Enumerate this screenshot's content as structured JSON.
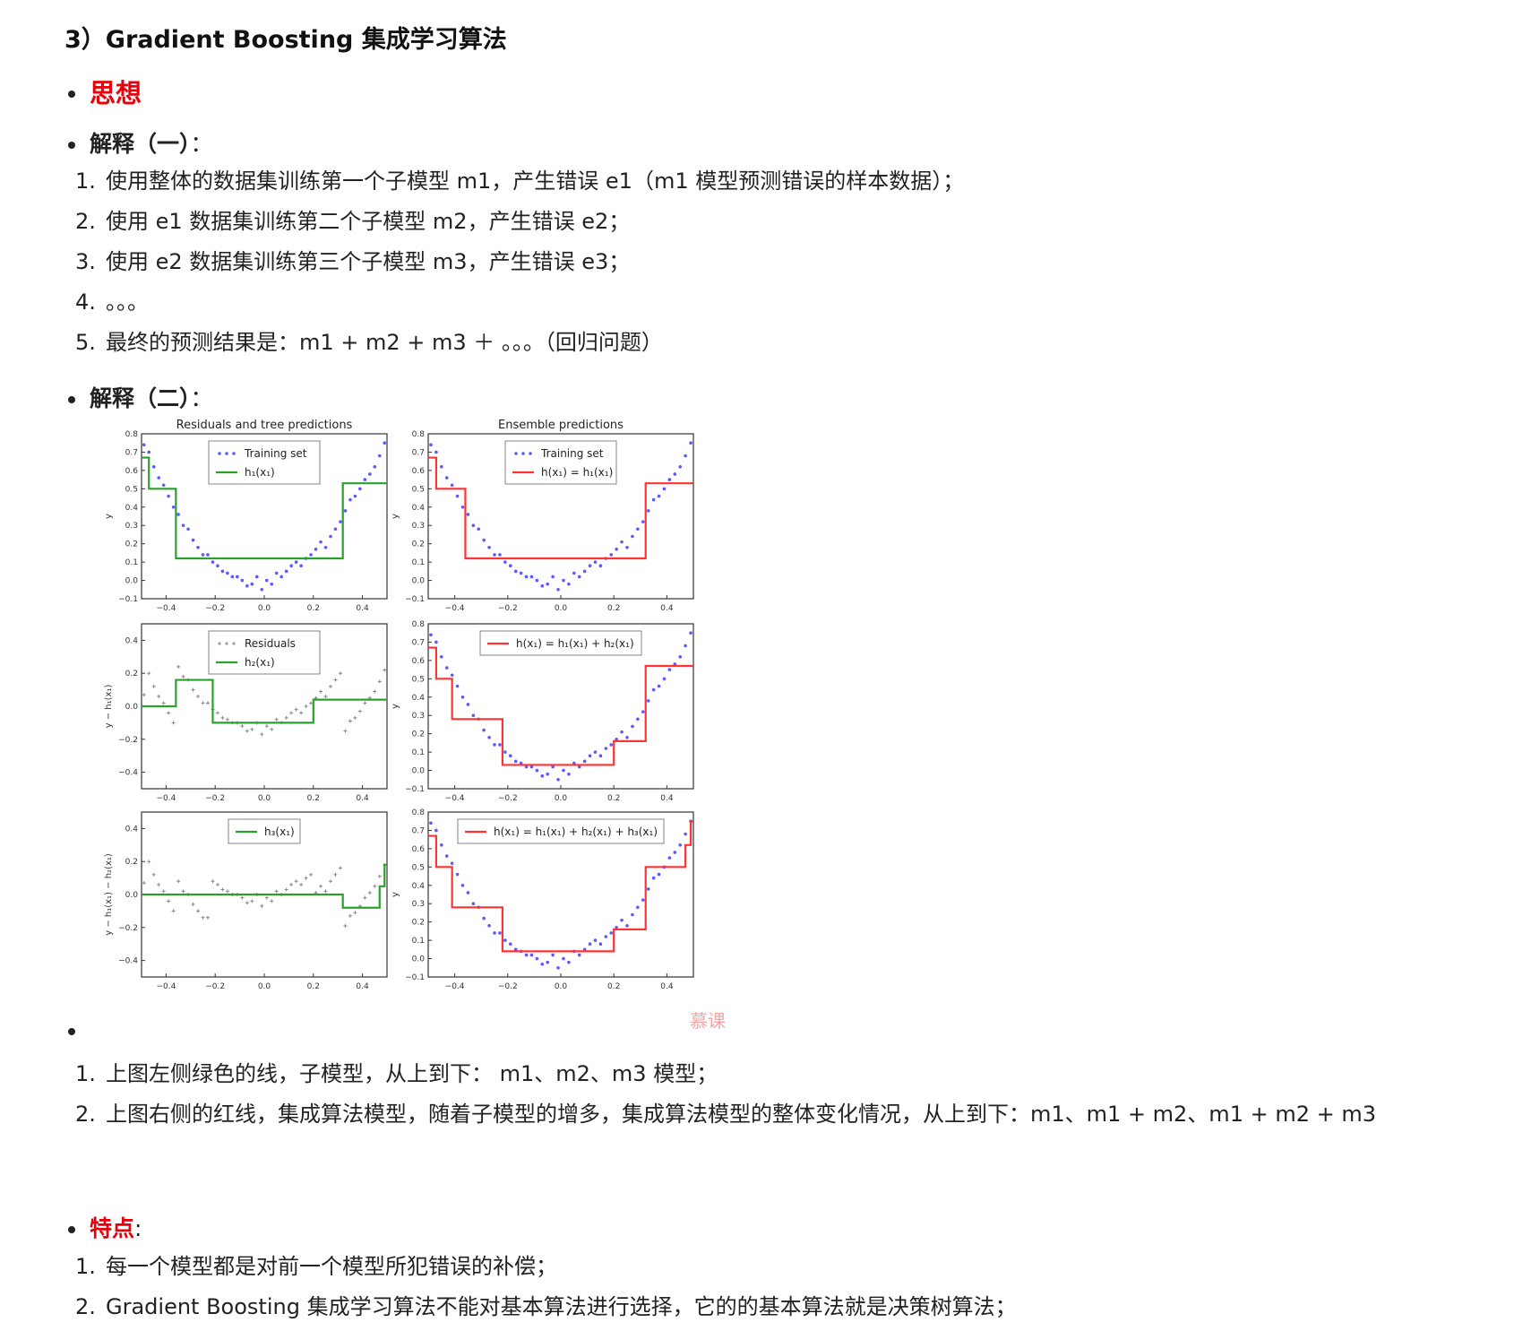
{
  "heading": "3）Gradient Boosting 集成学习算法",
  "idea": {
    "label": "思想"
  },
  "explain1": {
    "label": "解释（一）",
    "colon": "：",
    "items": [
      "使用整体的数据集训练第一个子模型 m1，产生错误 e1（m1 模型预测错误的样本数据）；",
      "使用 e1 数据集训练第二个子模型 m2，产生错误 e2；",
      "使用 e2 数据集训练第三个子模型 m3，产生错误 e3；",
      "。。。",
      "最终的预测结果是：m1 + m2 + m3 ＋ 。。。（回归问题）"
    ]
  },
  "explain2": {
    "label": "解释（二）",
    "colon": "：",
    "items": [
      "上图左侧绿色的线，子模型，从上到下： m1、m2、m3 模型；",
      "上图右侧的红线，集成算法模型，随着子模型的增多，集成算法模型的整体变化情况，从上到下：m1、m1 + m2、m1 + m2 + m3"
    ]
  },
  "features": {
    "label": "特点",
    "colon": ":",
    "items": [
      "每一个模型都是对前一个模型所犯错误的补偿；",
      "Gradient Boosting 集成学习算法不能对基本算法进行选择，它的的基本算法就是决策树算法；"
    ]
  },
  "figure": {
    "left_title": "Residuals and tree predictions",
    "right_title": "Ensemble predictions",
    "x_ticks": [
      "−0.4",
      "−0.2",
      "0.0",
      "0.2",
      "0.4"
    ],
    "y_ticks_top": [
      "0.8",
      "0.7",
      "0.6",
      "0.5",
      "0.4",
      "0.3",
      "0.2",
      "0.1",
      "0.0",
      "−0.1"
    ],
    "y_ticks_resid": [
      "0.4",
      "0.2",
      "0.0",
      "−0.2",
      "−0.4"
    ],
    "ylabels": {
      "y": "y",
      "resid1": "y − h₁(x₁)",
      "resid2": "y − h₁(x₁) − h₂(x₁)"
    },
    "legends": {
      "training": "Training set",
      "residuals": "Residuals",
      "h1": "h₁(x₁)",
      "h2": "h₂(x₁)",
      "h3": "h₃(x₁)",
      "e1": "h(x₁) = h₁(x₁)",
      "e2": "h(x₁) = h₁(x₁) + h₂(x₁)",
      "e3": "h(x₁) = h₁(x₁) + h₂(x₁) + h₃(x₁)"
    },
    "watermark": "慕课",
    "colors": {
      "green": "#2ca02c",
      "red": "#ff3333",
      "points": "#5a5aff",
      "residuals": "#888888"
    }
  },
  "chart_data": [
    {
      "type": "line",
      "title": "Residuals and tree predictions",
      "ylabel": "y",
      "xlim": [
        -0.5,
        0.5
      ],
      "ylim": [
        -0.1,
        0.8
      ],
      "series": [
        {
          "name": "Training set",
          "kind": "scatter",
          "x": [
            -0.49,
            -0.47,
            -0.45,
            -0.43,
            -0.41,
            -0.39,
            -0.37,
            -0.35,
            -0.33,
            -0.31,
            -0.29,
            -0.27,
            -0.25,
            -0.23,
            -0.21,
            -0.19,
            -0.17,
            -0.15,
            -0.13,
            -0.11,
            -0.09,
            -0.07,
            -0.05,
            -0.03,
            -0.01,
            0.01,
            0.03,
            0.05,
            0.07,
            0.09,
            0.11,
            0.13,
            0.15,
            0.17,
            0.19,
            0.21,
            0.23,
            0.25,
            0.27,
            0.29,
            0.31,
            0.33,
            0.35,
            0.37,
            0.39,
            0.41,
            0.43,
            0.45,
            0.47,
            0.49
          ],
          "y": [
            0.74,
            0.7,
            0.62,
            0.56,
            0.52,
            0.46,
            0.4,
            0.36,
            0.3,
            0.28,
            0.22,
            0.18,
            0.14,
            0.14,
            0.1,
            0.08,
            0.05,
            0.04,
            0.02,
            0.02,
            0.0,
            -0.03,
            -0.02,
            0.02,
            -0.05,
            0.0,
            -0.02,
            0.04,
            0.02,
            0.05,
            0.08,
            0.1,
            0.08,
            0.12,
            0.14,
            0.17,
            0.21,
            0.18,
            0.24,
            0.28,
            0.32,
            0.38,
            0.44,
            0.46,
            0.5,
            0.55,
            0.58,
            0.62,
            0.68,
            0.75
          ]
        },
        {
          "name": "h₁(x₁)",
          "kind": "step",
          "x": [
            -0.5,
            -0.47,
            -0.47,
            -0.43,
            -0.43,
            -0.36,
            -0.36,
            0.32,
            0.32,
            0.5
          ],
          "y": [
            0.67,
            0.67,
            0.5,
            0.5,
            0.5,
            0.5,
            0.12,
            0.12,
            0.53,
            0.53
          ]
        }
      ]
    },
    {
      "type": "line",
      "title": "Ensemble predictions",
      "ylabel": "y",
      "xlim": [
        -0.5,
        0.5
      ],
      "ylim": [
        -0.1,
        0.8
      ],
      "series": [
        {
          "name": "Training set",
          "kind": "scatter",
          "same_as": "left"
        },
        {
          "name": "h(x₁) = h₁(x₁)",
          "kind": "step",
          "x": [
            -0.5,
            -0.47,
            -0.47,
            -0.36,
            -0.36,
            0.32,
            0.32,
            0.5
          ],
          "y": [
            0.67,
            0.67,
            0.5,
            0.5,
            0.12,
            0.12,
            0.53,
            0.53
          ]
        }
      ]
    },
    {
      "type": "line",
      "ylabel": "y − h₁(x₁)",
      "xlim": [
        -0.5,
        0.5
      ],
      "ylim": [
        -0.5,
        0.5
      ],
      "series": [
        {
          "name": "Residuals",
          "kind": "scatter"
        },
        {
          "name": "h₂(x₁)",
          "kind": "step",
          "x": [
            -0.5,
            -0.36,
            -0.36,
            -0.21,
            -0.21,
            0.2,
            0.2,
            0.5
          ],
          "y": [
            0.0,
            0.0,
            0.16,
            0.16,
            -0.1,
            -0.1,
            0.04,
            0.04
          ]
        }
      ]
    },
    {
      "type": "line",
      "ylabel": "y",
      "xlim": [
        -0.5,
        0.5
      ],
      "ylim": [
        -0.1,
        0.8
      ],
      "series": [
        {
          "name": "Training set",
          "kind": "scatter"
        },
        {
          "name": "h(x₁) = h₁(x₁) + h₂(x₁)",
          "kind": "step",
          "x": [
            -0.5,
            -0.47,
            -0.47,
            -0.41,
            -0.41,
            -0.36,
            -0.36,
            -0.22,
            -0.22,
            0.2,
            0.2,
            0.32,
            0.32,
            0.5
          ],
          "y": [
            0.67,
            0.67,
            0.5,
            0.5,
            0.28,
            0.28,
            0.28,
            0.28,
            0.03,
            0.03,
            0.16,
            0.16,
            0.57,
            0.57
          ]
        }
      ]
    },
    {
      "type": "line",
      "ylabel": "y − h₁(x₁) − h₂(x₁)",
      "xlim": [
        -0.5,
        0.5
      ],
      "ylim": [
        -0.5,
        0.5
      ],
      "series": [
        {
          "name": "Residuals",
          "kind": "scatter"
        },
        {
          "name": "h₃(x₁)",
          "kind": "step",
          "x": [
            -0.5,
            0.32,
            0.32,
            0.47,
            0.47,
            0.49,
            0.49,
            0.5
          ],
          "y": [
            0.0,
            0.0,
            -0.08,
            -0.08,
            0.05,
            0.05,
            0.18,
            0.18
          ]
        }
      ]
    },
    {
      "type": "line",
      "ylabel": "y",
      "xlim": [
        -0.5,
        0.5
      ],
      "ylim": [
        -0.1,
        0.8
      ],
      "series": [
        {
          "name": "Training set",
          "kind": "scatter"
        },
        {
          "name": "h(x₁) = h₁(x₁) + h₂(x₁) + h₃(x₁)",
          "kind": "step",
          "x": [
            -0.5,
            -0.47,
            -0.47,
            -0.41,
            -0.41,
            -0.36,
            -0.36,
            -0.22,
            -0.22,
            0.2,
            0.2,
            0.32,
            0.32,
            0.47,
            0.47,
            0.49,
            0.49,
            0.5
          ],
          "y": [
            0.67,
            0.67,
            0.5,
            0.5,
            0.28,
            0.28,
            0.28,
            0.28,
            0.04,
            0.04,
            0.16,
            0.16,
            0.5,
            0.5,
            0.62,
            0.62,
            0.75,
            0.75
          ]
        }
      ]
    }
  ]
}
